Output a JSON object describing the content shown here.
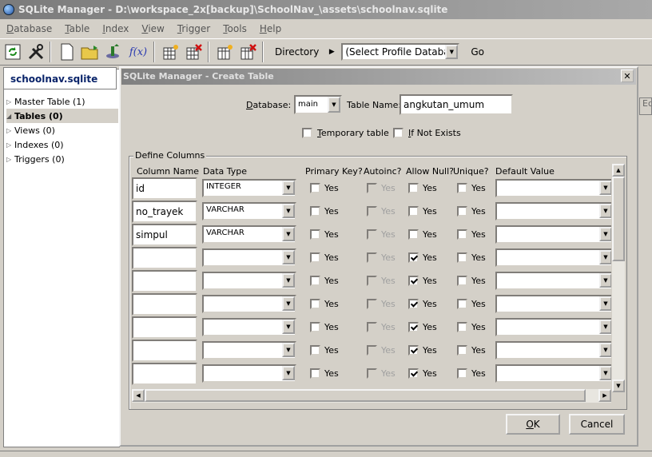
{
  "window": {
    "title": "SQLite Manager - D:\\workspace_2x[backup]\\SchoolNav_\\assets\\schoolnav.sqlite"
  },
  "menu": [
    "Database",
    "Table",
    "Index",
    "View",
    "Trigger",
    "Tools",
    "Help"
  ],
  "toolbar": {
    "directory_label": "Directory",
    "profile_select": "(Select Profile Database)",
    "go_label": "Go",
    "fx_label": "f(x)"
  },
  "sidebar": {
    "db_name": "schoolnav.sqlite",
    "items": [
      {
        "label": "Master Table (1)"
      },
      {
        "label": "Tables (0)"
      },
      {
        "label": "Views (0)"
      },
      {
        "label": "Indexes (0)"
      },
      {
        "label": "Triggers (0)"
      }
    ]
  },
  "right_strip_text": "Ed",
  "dialog": {
    "title": "SQLite Manager - Create Table",
    "database_label": "Database:",
    "database_value": "main",
    "table_name_label": "Table Name:",
    "table_name_value": "angkutan_umum",
    "temporary_label": "Temporary table",
    "if_not_exists_label": "If Not Exists",
    "group_label": "Define Columns",
    "headers": [
      "Column Name",
      "Data Type",
      "Primary Key?",
      "Autoinc?",
      "Allow Null?",
      "Unique?",
      "Default Value"
    ],
    "yes_label": "Yes",
    "rows": [
      {
        "name": "id",
        "type": "INTEGER",
        "allow_null": false
      },
      {
        "name": "no_trayek",
        "type": "VARCHAR",
        "allow_null": false
      },
      {
        "name": "simpul",
        "type": "VARCHAR",
        "allow_null": false
      },
      {
        "name": "",
        "type": "",
        "allow_null": true
      },
      {
        "name": "",
        "type": "",
        "allow_null": true
      },
      {
        "name": "",
        "type": "",
        "allow_null": true
      },
      {
        "name": "",
        "type": "",
        "allow_null": true
      },
      {
        "name": "",
        "type": "",
        "allow_null": true
      },
      {
        "name": "",
        "type": "",
        "allow_null": true
      }
    ],
    "ok_label": "OK",
    "cancel_label": "Cancel"
  }
}
